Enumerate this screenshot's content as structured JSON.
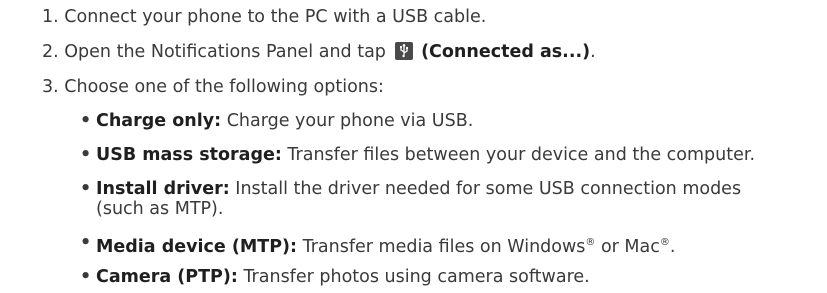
{
  "steps": [
    {
      "num": "1.",
      "text": "Connect your phone to the PC with a USB cable."
    },
    {
      "num": "2.",
      "text": "Open the Notifications Panel and tap ",
      "bold": "(Connected as...)",
      "after": "."
    },
    {
      "num": "3.",
      "text": "Choose one of the following options:"
    }
  ],
  "options": [
    {
      "bullet": "•",
      "label": "Charge only:",
      "text": " Charge your phone via USB."
    },
    {
      "bullet": "•",
      "label": "USB mass storage:",
      "text": " Transfer files between your device and the computer."
    },
    {
      "bullet": "•",
      "label": "Install driver:",
      "text": " Install the driver needed for some USB connection modes",
      "text2": "(such as MTP)."
    },
    {
      "bullet": "•",
      "label": "Media device (MTP):",
      "text": " Transfer media files on Windows",
      "reg1": "®",
      "mid": " or Mac",
      "reg2": "®",
      "end": "."
    },
    {
      "bullet": "•",
      "label": "Camera (PTP):",
      "text": " Transfer photos using camera software."
    }
  ],
  "icons": {
    "usb": "usb-icon"
  }
}
